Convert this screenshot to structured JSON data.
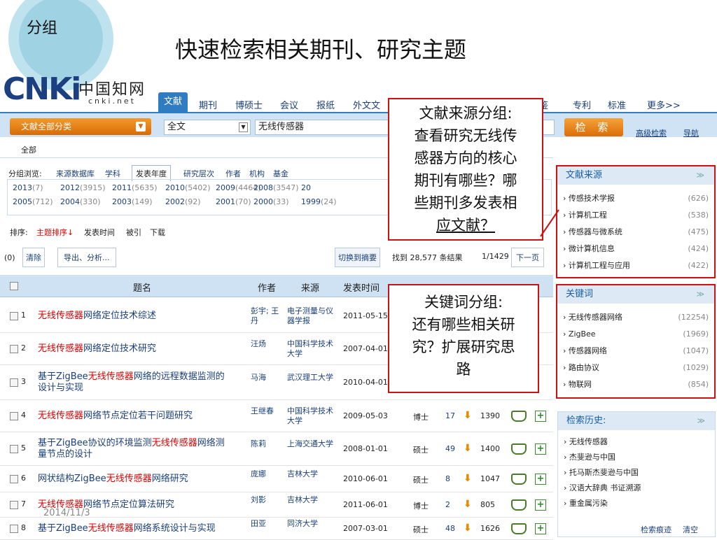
{
  "slide": {
    "tag": "分组",
    "title": "快速检索相关期刊、研究主题",
    "date": "2014/11/3"
  },
  "logo": {
    "mark": "CNKi",
    "cn": "中国知网",
    "url": "cnki.net"
  },
  "tabs": [
    "文献",
    "期刊",
    "博硕士",
    "会议",
    "报纸",
    "外文文",
    "鉴",
    "专利",
    "标准",
    "更多>>"
  ],
  "search": {
    "category": "文献全部分类",
    "field": "全文",
    "query": "无线传感器",
    "button": "检 索",
    "advanced": "高级检索",
    "nav": "导航"
  },
  "allbar": "全部",
  "group": {
    "label": "分组浏览:",
    "items": [
      "来源数据库",
      "学科",
      "发表年度",
      "研究层次",
      "作者",
      "机构",
      "基金"
    ],
    "years_row1": [
      [
        "2013",
        "(7)"
      ],
      [
        "2012",
        "(3915)"
      ],
      [
        "2011",
        "(5635)"
      ],
      [
        "2010",
        "(5402)"
      ],
      [
        "2009",
        "(4464)"
      ],
      [
        "2008",
        "(3547)"
      ],
      [
        "20",
        ""
      ]
    ],
    "years_row2": [
      [
        "2005",
        "(712)"
      ],
      [
        "2004",
        "(330)"
      ],
      [
        "2003",
        "(149)"
      ],
      [
        "2002",
        "(92)"
      ],
      [
        "2001",
        "(70)"
      ],
      [
        "2000",
        "(33)"
      ],
      [
        "1999",
        "(24)"
      ]
    ]
  },
  "sort": {
    "label": "排序:",
    "active": "主题排序↓",
    "others": [
      "发表时间",
      "被引",
      "下载"
    ]
  },
  "toolbar": {
    "count": "(0)",
    "clear": "清除",
    "export": "导出、分析...",
    "switch": "切换到摘要",
    "found": "找到 28,577 条结果",
    "page": "1/1429",
    "next": "下一页"
  },
  "table": {
    "headers": [
      "题名",
      "作者",
      "来源",
      "发表时间"
    ],
    "rows": [
      {
        "no": "1",
        "pre": "",
        "hl": "无线传感器",
        "post": "网络定位技术综述",
        "line2": "",
        "author": "彭宇; 王丹",
        "source": "电子测量与仪器学报",
        "date": "2011-05-15",
        "type": "",
        "cite": "",
        "dl": ""
      },
      {
        "no": "2",
        "pre": "",
        "hl": "无线传感器",
        "post": "网络定位技术研究",
        "line2": "",
        "author": "汪炀",
        "source": "中国科学技术大学",
        "date": "2007-04-01",
        "type": "",
        "cite": "",
        "dl": ""
      },
      {
        "no": "3",
        "pre": "基于ZigBee",
        "hl": "无线传感器",
        "post": "网络的远程数据监测的",
        "line2": "设计与实现",
        "author": "马海",
        "source": "武汉理工大学",
        "date": "2010-04-01",
        "type": "",
        "cite": "",
        "dl": ""
      },
      {
        "no": "4",
        "pre": "",
        "hl": "无线传感器",
        "post": "网络节点定位若干问题研究",
        "line2": "",
        "author": "王继春",
        "source": "中国科学技术大学",
        "date": "2009-05-03",
        "type": "博士",
        "cite": "17",
        "dl": "1390"
      },
      {
        "no": "5",
        "pre": "基于ZigBee协议的环境监测",
        "hl": "无线传感器",
        "post": "网络测",
        "line2": "量节点的设计",
        "author": "陈莉",
        "source": "上海交通大学",
        "date": "2008-01-01",
        "type": "硕士",
        "cite": "49",
        "dl": "1400"
      },
      {
        "no": "6",
        "pre": "网状结构ZigBee",
        "hl": "无线传感器",
        "post": "网络研究",
        "line2": "",
        "author": "庞娜",
        "source": "吉林大学",
        "date": "2010-06-01",
        "type": "硕士",
        "cite": "8",
        "dl": "1047"
      },
      {
        "no": "7",
        "pre": "",
        "hl": "无线传感器",
        "post": "网络节点定位算法研究",
        "line2": "",
        "author": "刘影",
        "source": "吉林大学",
        "date": "2011-06-01",
        "type": "博士",
        "cite": "2",
        "dl": "805"
      },
      {
        "no": "8",
        "pre": "基于ZigBee",
        "hl": "无线传感器",
        "post": "网络系统设计与实现",
        "line2": "",
        "author": "田亚",
        "source": "同济大学",
        "date": "2007-03-01",
        "type": "硕士",
        "cite": "48",
        "dl": "1626"
      }
    ]
  },
  "sidebar": {
    "source": {
      "title": "文献来源",
      "items": [
        [
          "传感技术学报",
          "(626)"
        ],
        [
          "计算机工程",
          "(538)"
        ],
        [
          "传感器与微系统",
          "(475)"
        ],
        [
          "微计算机信息",
          "(424)"
        ],
        [
          "计算机工程与应用",
          "(422)"
        ]
      ]
    },
    "keywords": {
      "title": "关键词",
      "items": [
        [
          "无线传感器网络",
          "(12254)"
        ],
        [
          "ZigBee",
          "(1969)"
        ],
        [
          "传感器网络",
          "(1047)"
        ],
        [
          "路由协议",
          "(1029)"
        ],
        [
          "物联网",
          "(854)"
        ]
      ]
    },
    "history": {
      "title": "检索历史:",
      "items": [
        "无线传感器",
        "杰斐逊与中国",
        "托马斯杰斐逊与中国",
        "汉语大辞典 书证溯源",
        "重金属污染"
      ],
      "trace": "检索痕迹",
      "clear": "清空"
    }
  },
  "callouts": {
    "source": [
      "文献来源分组:",
      "查看研究无线传",
      "感器方向的核心",
      "期刊有哪些？哪",
      "些期刊多发表相",
      "应文献？"
    ],
    "keyword": [
      "关键词分组:",
      "还有哪些相关研",
      "究？扩展研究思",
      "路"
    ]
  },
  "colors": {
    "accent": "#2f7cc2",
    "orange": "#e8840e",
    "highlight": "#dd0000",
    "callout_border": "#d01010"
  }
}
